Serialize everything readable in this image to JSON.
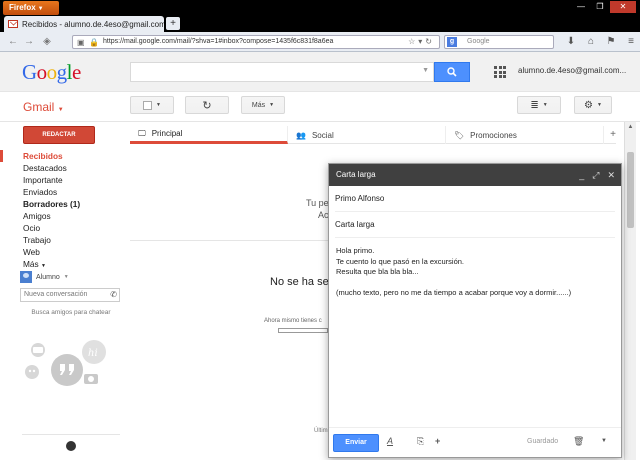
{
  "browser": {
    "menu_label": "Firefox",
    "tab_title": "Recibidos - alumno.de.4eso@gmail.com - G...",
    "tab_close": "×",
    "new_tab": "+",
    "url": "https://mail.google.com/mail/?shva=1#inbox?compose=1435f6c831f8a6ea",
    "search_placeholder": "Google",
    "search_engine": "g"
  },
  "header": {
    "account": "alumno.de.4eso@gmail.com..."
  },
  "toolbar": {
    "gmail_label": "Gmail",
    "more_label": "Más"
  },
  "sidebar": {
    "compose_label": "REDACTAR",
    "items": [
      {
        "label": "Recibidos",
        "state": "active"
      },
      {
        "label": "Destacados",
        "state": ""
      },
      {
        "label": "Importante",
        "state": ""
      },
      {
        "label": "Enviados",
        "state": ""
      },
      {
        "label": "Borradores (1)",
        "state": "bold"
      },
      {
        "label": "Amigos",
        "state": ""
      },
      {
        "label": "Ocio",
        "state": ""
      },
      {
        "label": "Trabajo",
        "state": ""
      },
      {
        "label": "Web",
        "state": ""
      },
      {
        "label": "Más",
        "state": ""
      }
    ],
    "chat_user": "Alumno",
    "chat_placeholder": "Nueva conversación",
    "find_friends": "Busca amigos para chatear"
  },
  "tabs": [
    {
      "label": "Principal",
      "icon": "inbox-icon"
    },
    {
      "label": "Social",
      "icon": "people-icon"
    },
    {
      "label": "Promociones",
      "icon": "tag-icon"
    }
  ],
  "background": {
    "line1": "Tu pe",
    "line2": "Ac",
    "title": "No se ha sele",
    "small": "Ahora mismo tienes c",
    "bottom": "Últim"
  },
  "compose": {
    "title": "Carta larga",
    "to": "Primo Alfonso",
    "subject": "Carta larga",
    "body_lines": [
      "Hola primo.",
      "Te cuento lo que pasó en la excursión.",
      "Resulta que bla bla bla..."
    ],
    "body_extra": "(mucho texto, pero no me da tiempo a acabar porque voy a dormir......)",
    "send_label": "Enviar",
    "saved_label": "Guardado"
  },
  "colors": {
    "accent_red": "#dd4b39",
    "blue": "#4d90fe",
    "compose_header": "#404040"
  }
}
